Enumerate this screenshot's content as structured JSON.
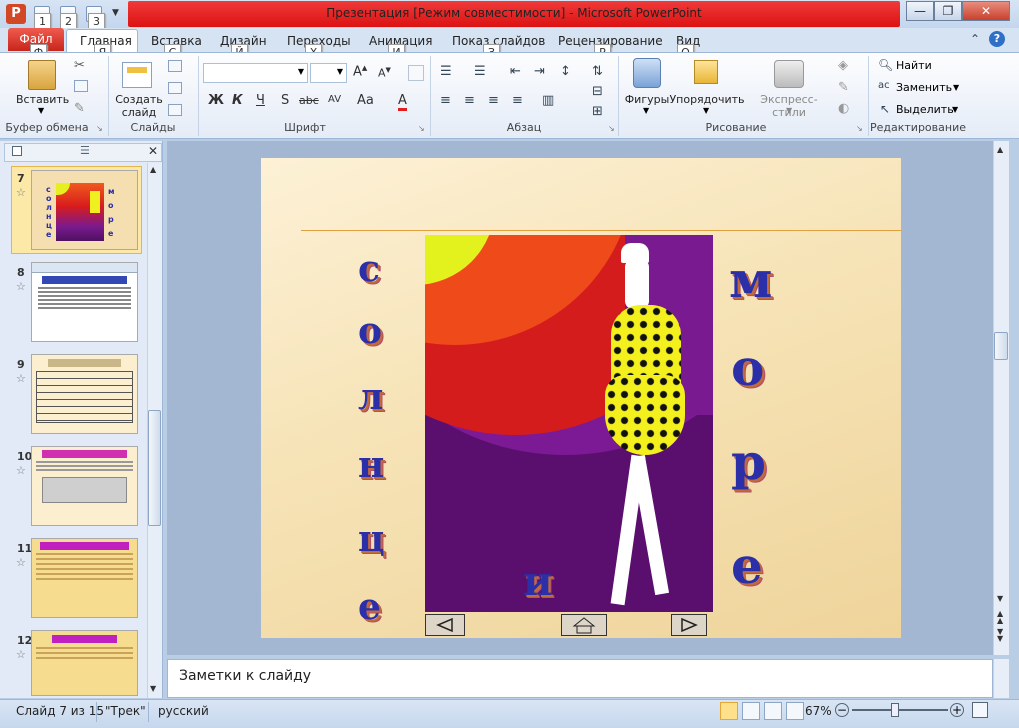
{
  "window": {
    "title": "Презентация [Режим совместимости]  -  Microsoft PowerPoint"
  },
  "keytips": {
    "qat1": "1",
    "qat2": "2",
    "qat3": "3",
    "file": "Ф",
    "home": "Я",
    "insert": "С",
    "design": "Й",
    "transitions": "Х",
    "animations": "И",
    "slideshow": "З",
    "review": "Р",
    "view": "О"
  },
  "tabs": {
    "file": "Файл",
    "home": "Главная",
    "insert": "Вставка",
    "design": "Дизайн",
    "transitions": "Переходы",
    "animations": "Анимация",
    "slideshow": "Показ слайдов",
    "review": "Рецензирование",
    "view": "Вид"
  },
  "ribbon": {
    "paste": "Вставить",
    "new_slide_1": "Создать",
    "new_slide_2": "слайд",
    "shapes": "Фигуры",
    "arrange": "Упорядочить",
    "quick_styles": "Экспресс-стили",
    "find": "Найти",
    "replace": "Заменить",
    "select": "Выделить",
    "groups": {
      "clipboard": "Буфер обмена",
      "slides": "Слайды",
      "font": "Шрифт",
      "paragraph": "Абзац",
      "drawing": "Рисование",
      "editing": "Редактирование"
    },
    "font_buttons": [
      "Ж",
      "К",
      "Ч",
      "S",
      "abc",
      "AV",
      "Aa",
      "A"
    ]
  },
  "slides_panel": {
    "items": [
      {
        "num": "7",
        "star": "☆"
      },
      {
        "num": "8",
        "star": "☆"
      },
      {
        "num": "9",
        "star": "☆"
      },
      {
        "num": "10",
        "star": "☆"
      },
      {
        "num": "11",
        "star": "☆"
      },
      {
        "num": "12",
        "star": "☆"
      }
    ]
  },
  "slide": {
    "left_word": [
      "с",
      "о",
      "л",
      "н",
      "ц",
      "е"
    ],
    "right_word": [
      "м",
      "о",
      "р",
      "е"
    ],
    "middle": "и"
  },
  "notes": {
    "placeholder": "Заметки к слайду"
  },
  "status": {
    "slide": "Слайд 7 из 15",
    "theme": "\"Трек\"",
    "language": "русский",
    "zoom": "67%",
    "zoom_fraction": 0.45
  },
  "colors": {
    "accent": "#e61e1e",
    "file_tab": "#d0392c",
    "slide_text": "#2b2fa8"
  }
}
